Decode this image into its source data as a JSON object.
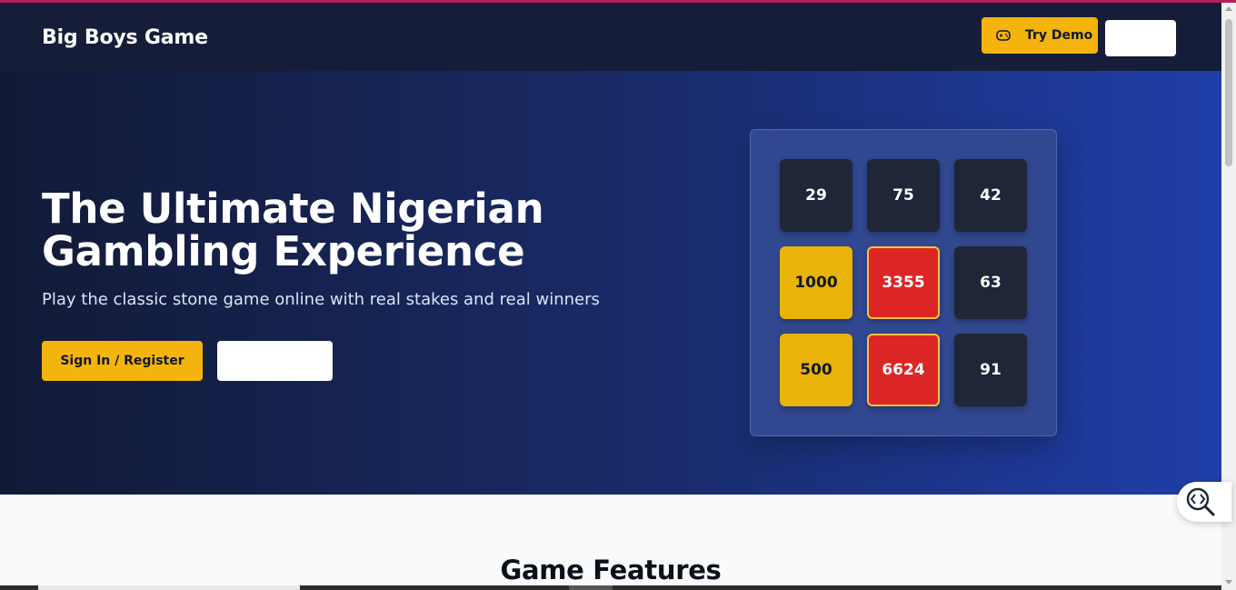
{
  "nav": {
    "brand": "Big Boys Game",
    "try_demo_label": "Try Demo",
    "try_demo_icon": "gamepad-icon",
    "secondary_button_label": ""
  },
  "hero": {
    "title_line1": "The Ultimate Nigerian",
    "title_line2": "Gambling Experience",
    "subtitle": "Play the classic stone game online with real stakes and real winners",
    "signin_label": "Sign In / Register",
    "secondary_button_label": ""
  },
  "board": {
    "tiles": [
      {
        "value": "29",
        "style": "dark"
      },
      {
        "value": "75",
        "style": "dark"
      },
      {
        "value": "42",
        "style": "dark"
      },
      {
        "value": "1000",
        "style": "gold"
      },
      {
        "value": "3355",
        "style": "red"
      },
      {
        "value": "63",
        "style": "dark"
      },
      {
        "value": "500",
        "style": "gold"
      },
      {
        "value": "6624",
        "style": "red"
      },
      {
        "value": "91",
        "style": "dark"
      }
    ]
  },
  "features": {
    "title": "Game Features"
  },
  "colors": {
    "accent_gold": "#f4b40d",
    "tile_red": "#dc2626",
    "tile_dark": "#1e2638",
    "nav_bg": "#151d38"
  },
  "widgets": {
    "devtool_icon": "code-search-icon"
  }
}
